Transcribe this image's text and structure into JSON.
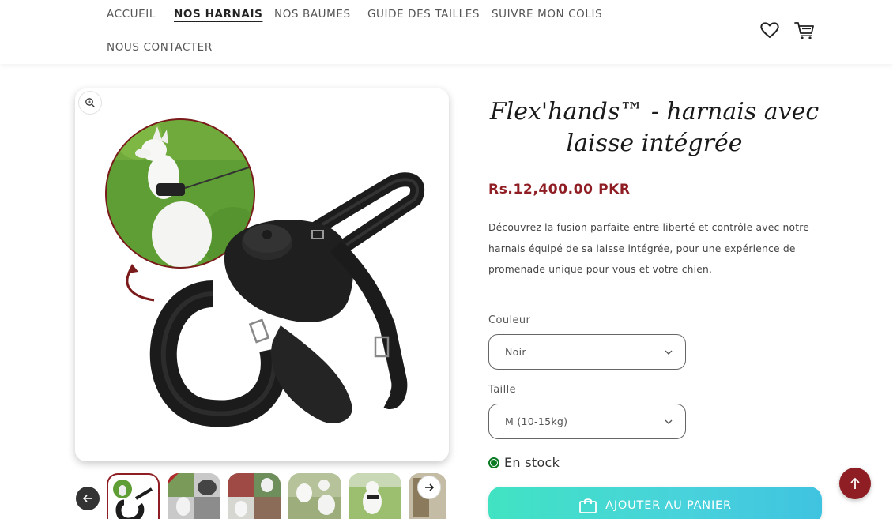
{
  "nav": {
    "items": [
      {
        "label": "ACCUEIL"
      },
      {
        "label": "NOS HARNAIS",
        "active": true
      },
      {
        "label": "NOS BAUMES"
      },
      {
        "label": "GUIDE DES TAILLES"
      },
      {
        "label": "SUIVRE MON COLIS"
      },
      {
        "label": "NOUS CONTACTER"
      }
    ],
    "icons": [
      "heart-icon",
      "cart-icon"
    ]
  },
  "gallery": {
    "main_image": "black dog harness with integrated leash, inset photo of white dog on grass",
    "thumbnail_count": 6,
    "selected_thumbnail": 1,
    "icons": [
      "zoom-icon",
      "arrow-left-icon",
      "arrow-right-icon"
    ]
  },
  "product": {
    "title": "Flex'hands™ - harnais avec laisse intégrée",
    "price": "Rs.12,400.00 PKR",
    "description": "Découvrez la fusion parfaite entre liberté et contrôle avec notre harnais équipé de sa laisse intégrée, pour une expérience de promenade unique pour vous et votre chien.",
    "options": {
      "color_label": "Couleur",
      "color_value": "Noir",
      "size_label": "Taille",
      "size_value": "M (10-15kg)"
    },
    "stock": "En stock",
    "add_to_cart": "AJOUTER AU PANIER"
  },
  "colors": {
    "accent": "#8f1e24",
    "price": "#8f1e24",
    "stock": "#0a7a23",
    "button_gradient_start": "#41e3c3",
    "button_gradient_end": "#3fc3e0"
  }
}
